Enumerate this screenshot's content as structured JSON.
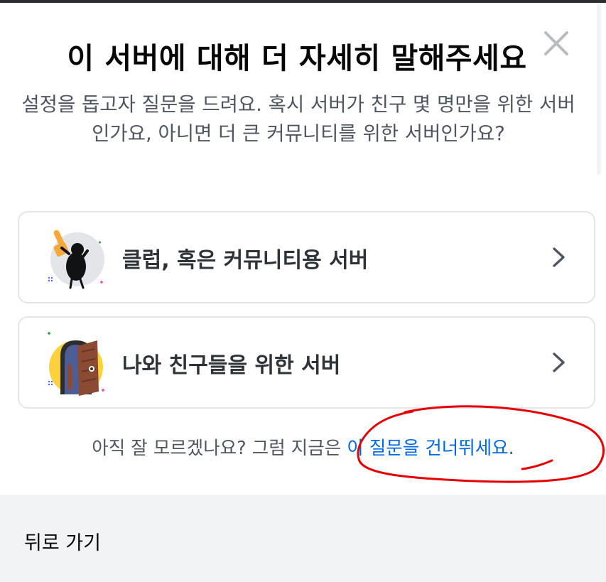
{
  "modal": {
    "title": "이 서버에 대해 더 자세히 말해주세요",
    "subtitle": "설정을 돕고자 질문을 드려요. 혹시 서버가 친구 몇 명만을 위한 서버인가요, 아니면 더 큰 커뮤니티를 위한 서버인가요?",
    "close_icon": "close-icon"
  },
  "options": [
    {
      "label": "클럽, 혹은 커뮤니티용 서버",
      "icon": "club-community-illustration"
    },
    {
      "label": "나와 친구들을 위한 서버",
      "icon": "friends-door-illustration"
    }
  ],
  "skip": {
    "prefix": "아직 잘 모르겠나요? 그럼 지금은 ",
    "link": "이 질문을 건너뛰세요",
    "suffix": "."
  },
  "footer": {
    "back_label": "뒤로 가기"
  },
  "colors": {
    "title": "#060607",
    "body_text": "#4f5660",
    "link": "#0068e0",
    "card_border": "#e3e5e8",
    "footer_bg": "#f2f3f5",
    "annotation": "#e60000"
  }
}
